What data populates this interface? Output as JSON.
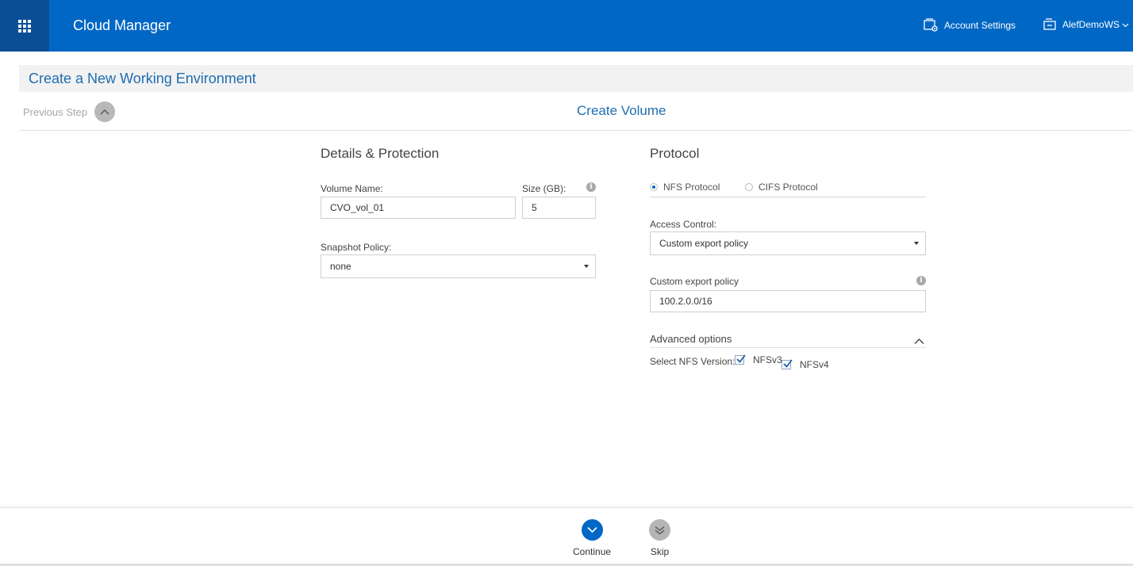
{
  "header": {
    "app_title": "Cloud Manager",
    "account_settings_label": "Account Settings",
    "workspace_label": "AlefDemoWS",
    "brand_color": "#0067c5",
    "apps_button_color": "#0a4f96"
  },
  "page": {
    "title": "Create a New Working Environment",
    "previous_step_label": "Previous Step",
    "step_title": "Create Volume"
  },
  "details": {
    "section_title": "Details & Protection",
    "volume_name_label": "Volume Name:",
    "volume_name_value": "CVO_vol_01",
    "size_label": "Size (GB):",
    "size_value": "5",
    "snapshot_policy_label": "Snapshot Policy:",
    "snapshot_policy_value": "none"
  },
  "protocol": {
    "section_title": "Protocol",
    "options": [
      {
        "label": "NFS Protocol",
        "selected": true
      },
      {
        "label": "CIFS Protocol",
        "selected": false
      }
    ],
    "access_control_label": "Access Control:",
    "access_control_value": "Custom export policy",
    "custom_export_label": "Custom export policy",
    "custom_export_value": "100.2.0.0/16",
    "advanced_options_label": "Advanced options",
    "nfs_version_label": "Select NFS Version:",
    "nfs_versions": [
      {
        "label": "NFSv3",
        "checked": true
      },
      {
        "label": "NFSv4",
        "checked": true
      }
    ]
  },
  "footer": {
    "continue_label": "Continue",
    "skip_label": "Skip"
  },
  "icons": {
    "apps": "grid-icon",
    "account_settings": "settings-gear-icon",
    "workspace": "workspace-icon",
    "previous_step": "chevron-up-icon",
    "info": "info-icon",
    "continue": "chevron-down-circle-icon",
    "skip": "double-chevron-down-icon"
  }
}
